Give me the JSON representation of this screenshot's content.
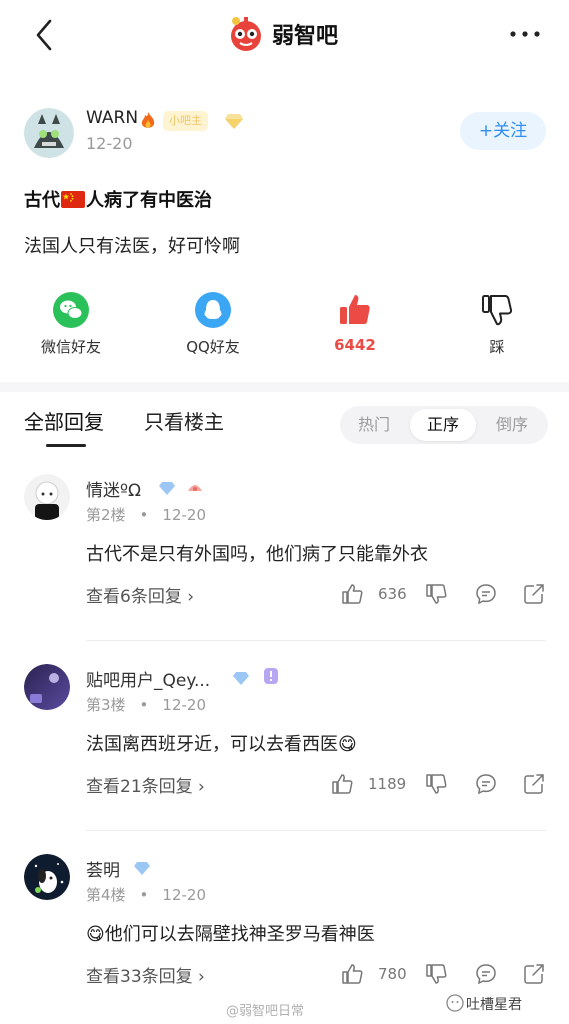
{
  "header": {
    "forum_name": "弱智吧",
    "back_icon": "chevron-left-icon",
    "more_icon": "more-dots-icon"
  },
  "post": {
    "author": "WARN",
    "author_badge": "小吧主",
    "date": "12-20",
    "follow_label": "+关注",
    "title_part1": "古代",
    "title_part2": "人病了有中医治",
    "body": "法国人只有法医，好可怜啊"
  },
  "share": {
    "wechat": "微信好友",
    "qq": "QQ好友",
    "likes": "6442",
    "dislike": "踩"
  },
  "tabs": {
    "all": "全部回复",
    "host_only": "只看楼主",
    "sort": [
      "热门",
      "正序",
      "倒序"
    ],
    "active_sort": "正序"
  },
  "comments": [
    {
      "user": "情迷ºΩ",
      "floor": "第2楼",
      "date": "12-20",
      "text": "古代不是只有外国吗，他们病了只能靠外衣",
      "replies": "查看6条回复",
      "likes": "636"
    },
    {
      "user": "贴吧用户_Qey...",
      "floor": "第3楼",
      "date": "12-20",
      "text": "法国离西班牙近，可以去看西医😋",
      "replies": "查看21条回复",
      "likes": "1189"
    },
    {
      "user": "荟明",
      "floor": "第4楼",
      "date": "12-20",
      "text": "😋他们可以去隔壁找神圣罗马看神医",
      "replies": "查看33条回复",
      "likes": "780"
    }
  ],
  "watermarks": {
    "center": "@弱智吧日常",
    "right": "吐槽星君"
  },
  "colors": {
    "accent_blue": "#2f8ef2",
    "like_red": "#ec4a44",
    "wechat_green": "#2bc15a",
    "qq_blue": "#3aa6f4"
  }
}
